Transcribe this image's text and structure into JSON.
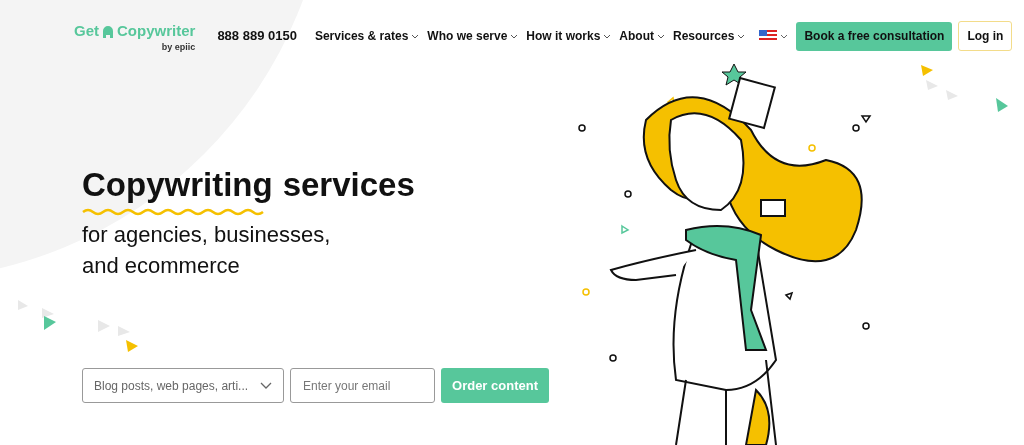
{
  "header": {
    "logo": {
      "word_1": "Get",
      "word_2": "Copywriter",
      "tagline": "by epiic"
    },
    "phone": "888 889 0150",
    "nav": [
      {
        "label": "Services & rates"
      },
      {
        "label": "Who we serve"
      },
      {
        "label": "How it works"
      },
      {
        "label": "About"
      },
      {
        "label": "Resources"
      }
    ],
    "cta": "Book a free consultation",
    "login": "Log in"
  },
  "hero": {
    "title_highlight": "Copywriting",
    "title_rest": "services",
    "subtitle_lines": [
      "for agencies, businesses,",
      "and ecommerce"
    ],
    "form": {
      "select_value": "Blog posts, web pages, arti...",
      "email_placeholder": "Enter your email",
      "submit": "Order content"
    }
  }
}
